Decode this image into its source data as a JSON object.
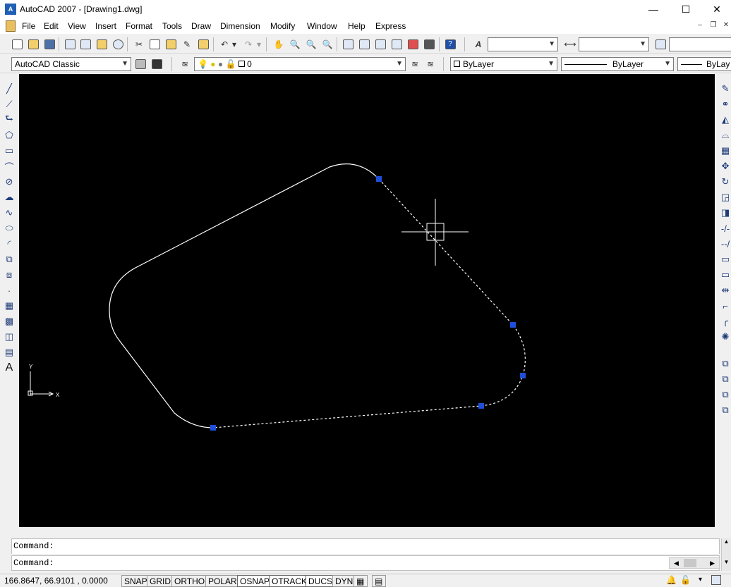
{
  "window": {
    "title": "AutoCAD 2007 - [Drawing1.dwg]",
    "app_icon": "autocad-icon",
    "minimize": "—",
    "maximize": "☐",
    "close": "✕"
  },
  "menu": [
    "File",
    "Edit",
    "View",
    "Insert",
    "Format",
    "Tools",
    "Draw",
    "Dimension",
    "Modify",
    "Window",
    "Help",
    "Express"
  ],
  "workspace": {
    "value": "AutoCAD Classic"
  },
  "layer": {
    "value": "0"
  },
  "properties": {
    "color": "ByLayer",
    "linetype": "ByLayer",
    "lineweight": "ByLay"
  },
  "text_style": {
    "value": ""
  },
  "dim_style": {
    "value": ""
  },
  "ucs": {
    "y_label": "Y",
    "x_label": "X"
  },
  "command": {
    "history_line": "Command:",
    "prompt": "Command:"
  },
  "status": {
    "coordinates": "166.8647, 66.9101 , 0.0000",
    "toggles": [
      {
        "label": "SNAP",
        "on": false
      },
      {
        "label": "GRID",
        "on": false
      },
      {
        "label": "ORTHO",
        "on": false
      },
      {
        "label": "POLAR",
        "on": false
      },
      {
        "label": "OSNAP",
        "on": true
      },
      {
        "label": "OTRACK",
        "on": true
      },
      {
        "label": "DUCS",
        "on": true
      },
      {
        "label": "DYN",
        "on": false
      }
    ]
  },
  "colors": {
    "canvas": "#000000",
    "grip": "#1f4fd8",
    "geometry": "#ffffff"
  }
}
